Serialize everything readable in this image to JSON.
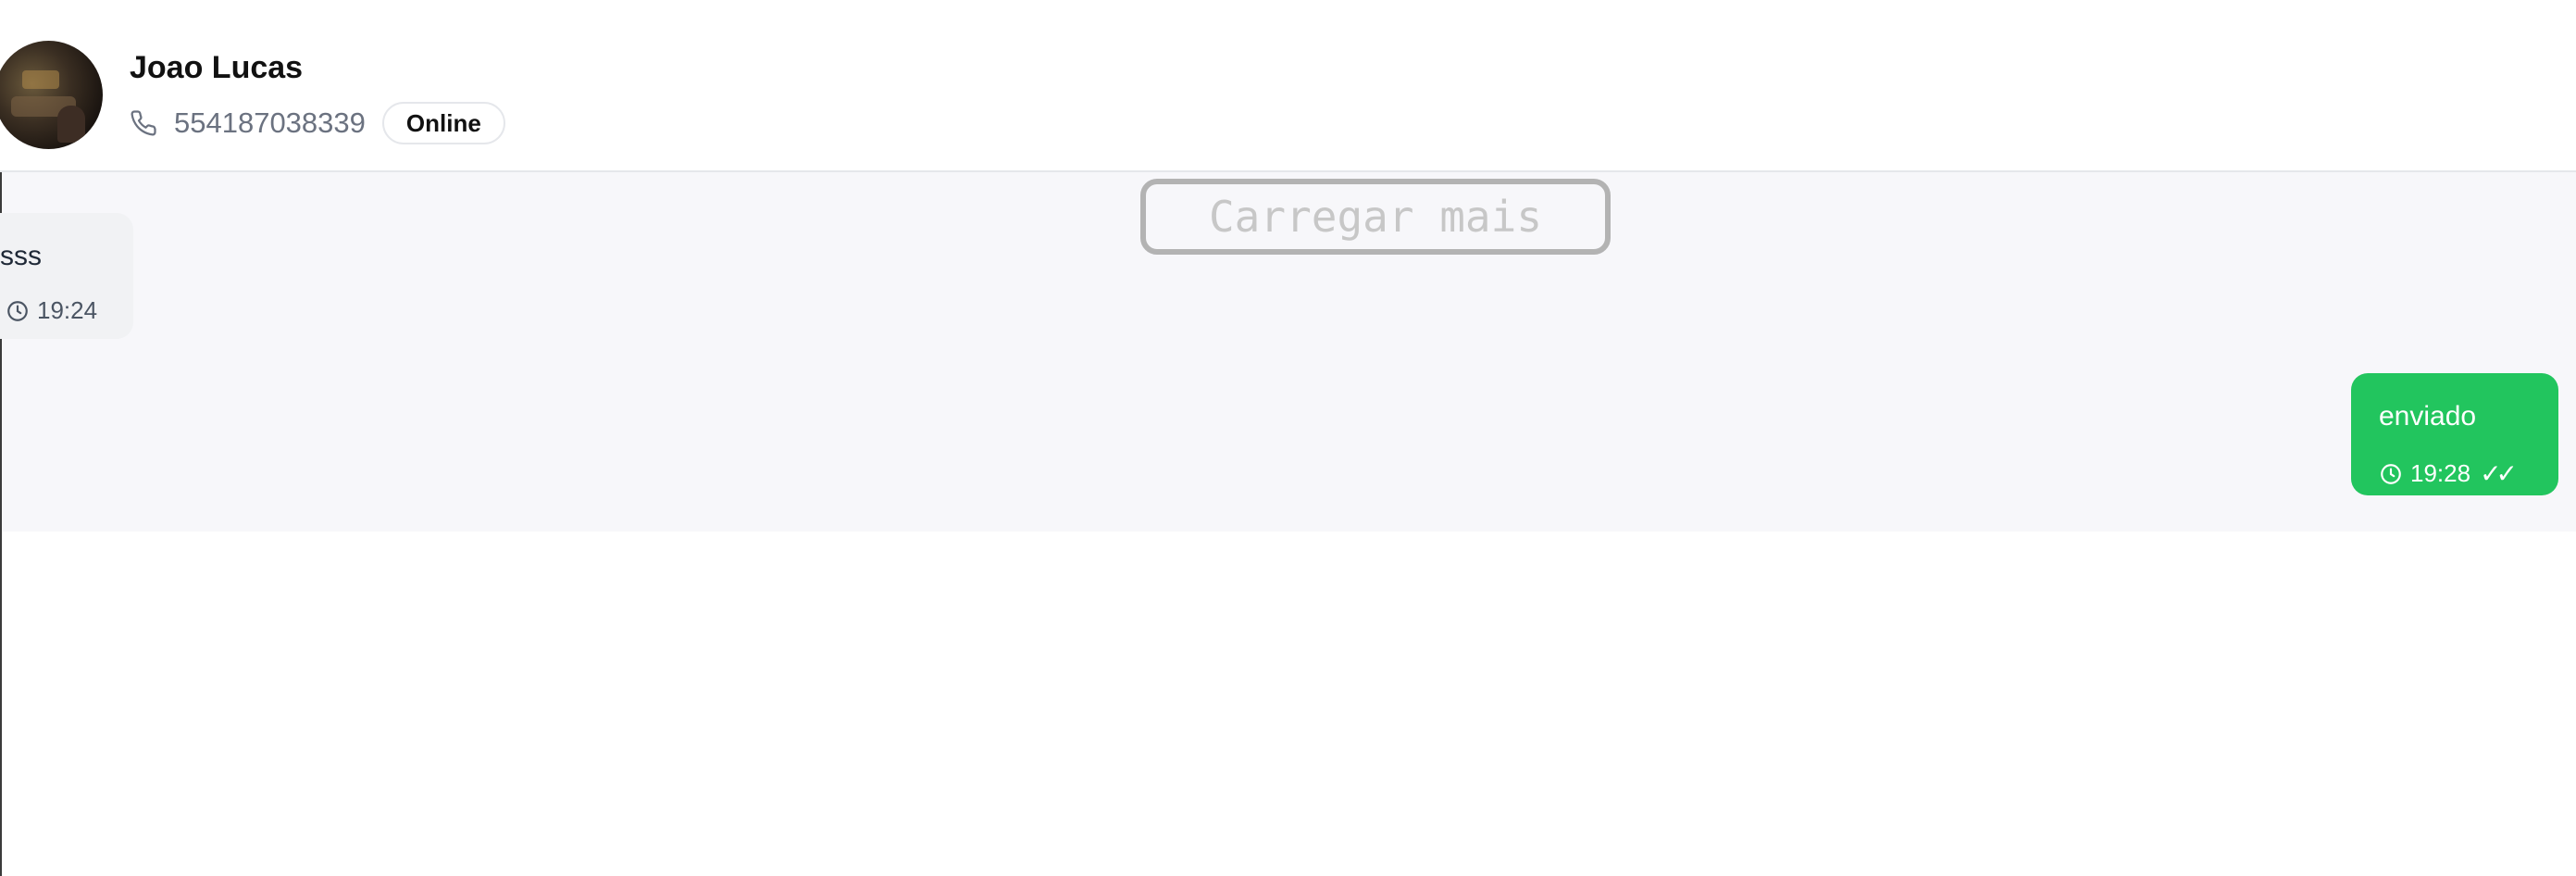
{
  "header": {
    "contact_name": "Joao Lucas",
    "phone": "554187038339",
    "status_badge": "Online"
  },
  "chat": {
    "load_more_label": "Carregar mais",
    "messages": [
      {
        "direction": "incoming",
        "text": "sss",
        "time": "19:24"
      },
      {
        "direction": "outgoing",
        "text": "enviado",
        "time": "19:28",
        "read_receipt": "✓✓"
      }
    ]
  },
  "icons": {
    "phone": "phone-icon",
    "clock": "clock-icon",
    "read": "double-check-icon"
  },
  "colors": {
    "outgoing_bubble": "#22c55e",
    "incoming_bubble": "#f1f2f4",
    "chat_background": "#f7f7fa",
    "muted_text": "#6b7280"
  }
}
